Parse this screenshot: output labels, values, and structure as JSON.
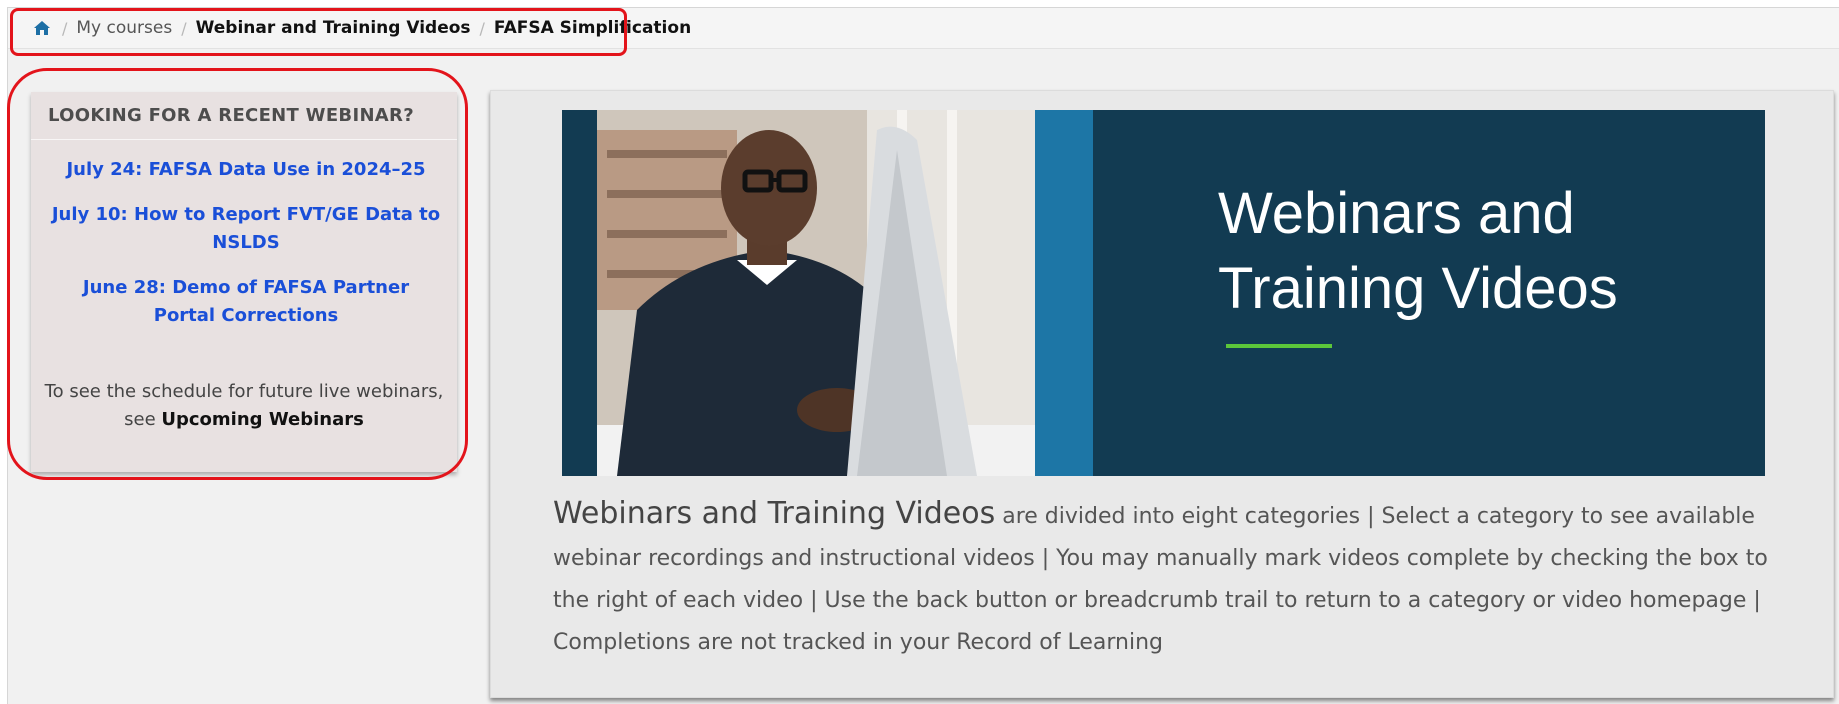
{
  "breadcrumb": {
    "home_icon": "home-icon",
    "items": [
      "My courses",
      "Webinar and Training Videos",
      "FAFSA Simplification"
    ],
    "separator": "/"
  },
  "sidebar": {
    "title": "LOOKING FOR A RECENT WEBINAR?",
    "links": [
      "July 24: FAFSA Data Use in 2024–25",
      "July 10: How to Report FVT/GE Data to NSLDS",
      "June 28: Demo of FAFSA Partner Portal Corrections"
    ],
    "schedule_prefix": "To see the schedule for future live webinars, see ",
    "schedule_link": "Upcoming Webinars"
  },
  "banner": {
    "title_line1": "Webinars and",
    "title_line2": "Training Videos"
  },
  "description": {
    "lead": "Webinars and Training Videos",
    "body": " are divided into eight categories  |  Select a category to see available webinar recordings and instructional videos  |  You may manually mark videos complete by checking the box to the right of each video  |  Use the back button or breadcrumb trail to return to a category or video homepage | Completions are not tracked in your Record of Learning"
  },
  "colors": {
    "annotation_red": "#e3141b",
    "link_blue": "#1a4fd8",
    "banner_navy": "#123b52",
    "banner_accent": "#1d76a6",
    "underline_green": "#5cc63a"
  }
}
